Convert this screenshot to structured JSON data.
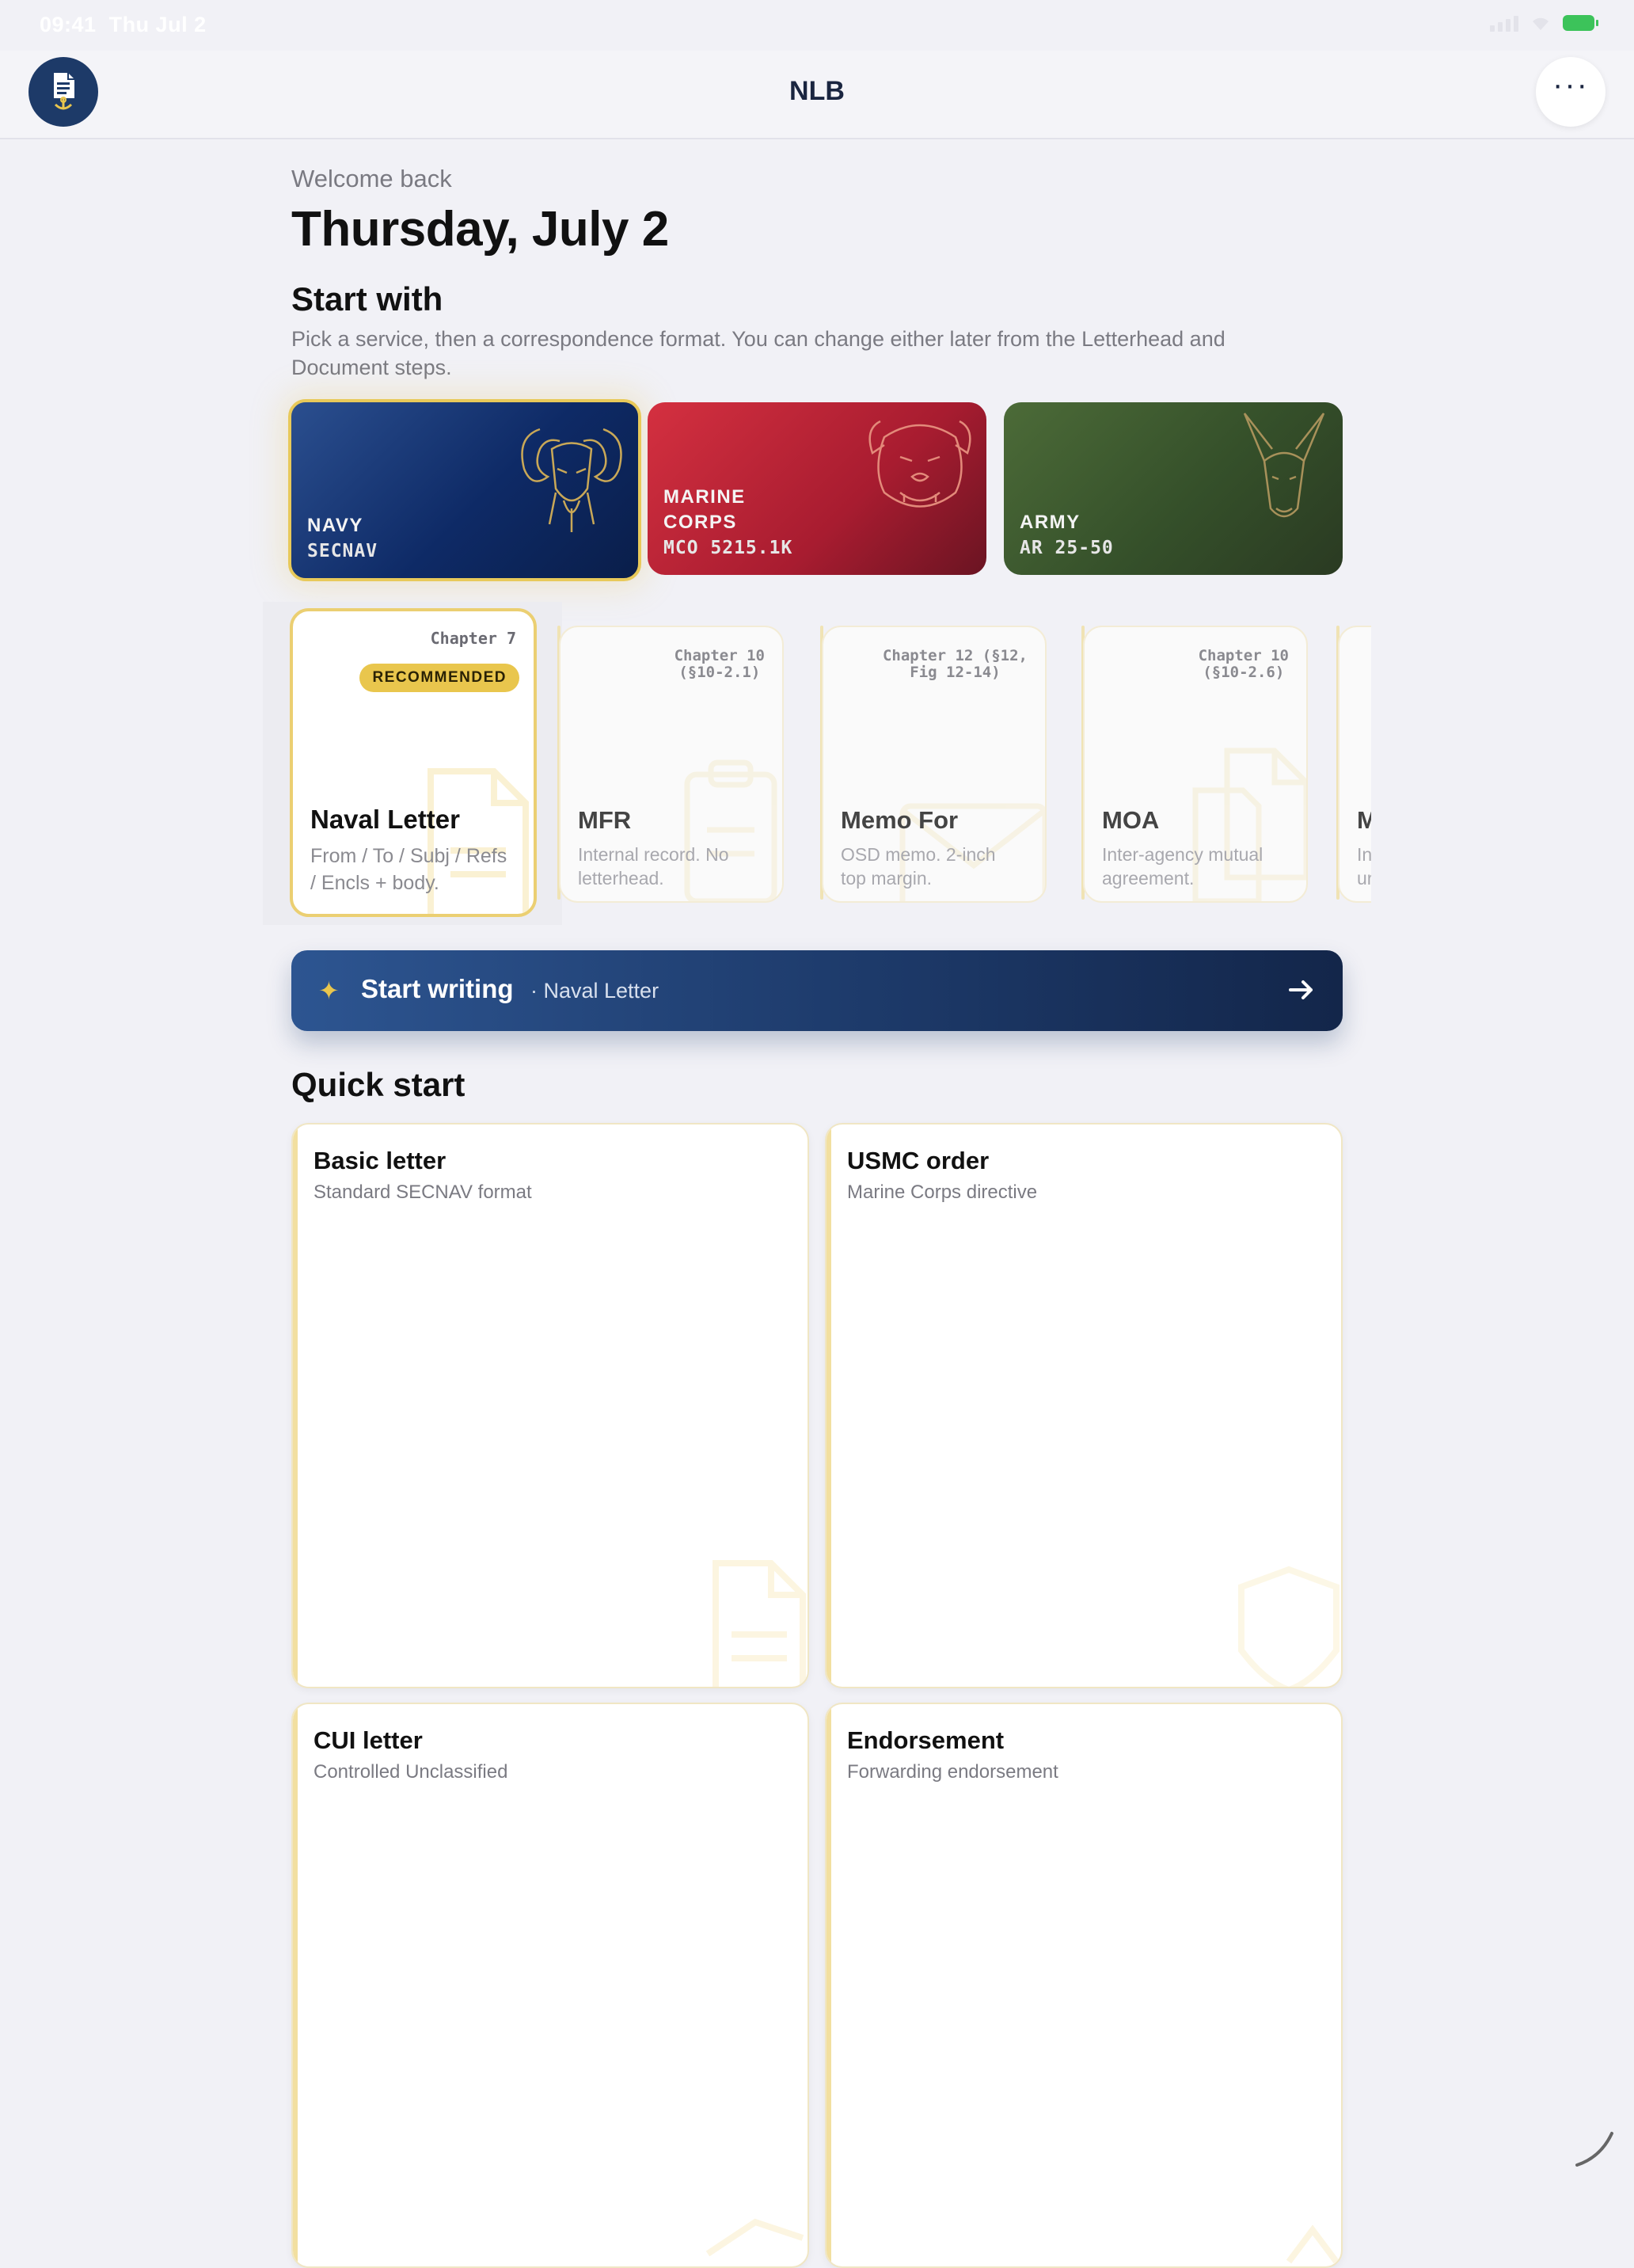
{
  "status_bar": {
    "time": "09:41",
    "date": "Thu Jul 2"
  },
  "nav": {
    "title": "NLB",
    "logo_icon": "anchor-document-icon",
    "menu_icon": "more-icon"
  },
  "header": {
    "welcome": "Welcome back",
    "date": "Thursday, July 2"
  },
  "start_with": {
    "title": "Start with",
    "subtitle": "Pick a service, then a correspondence format. You can change either later from the Letterhead and Document steps."
  },
  "services": [
    {
      "name": "NAVY",
      "code": "SECNAV",
      "selected": true,
      "mascot": "ram-icon"
    },
    {
      "name": "MARINE\nCORPS",
      "code": "MCO 5215.1K",
      "selected": false,
      "mascot": "bulldog-icon"
    },
    {
      "name": "ARMY",
      "code": "AR 25-50",
      "selected": false,
      "mascot": "mule-icon"
    }
  ],
  "formats": [
    {
      "chapter": "Chapter 7",
      "badge": "RECOMMENDED",
      "name": "Naval Letter",
      "desc": "From / To / Subj / Refs / Encls + body.",
      "selected": true
    },
    {
      "chapter": "Chapter 10\n(§10-2.1)",
      "name": "MFR",
      "desc": "Internal record. No letterhead."
    },
    {
      "chapter": "Chapter 12 (§12,\nFig 12-14)",
      "name": "Memo For",
      "desc": "OSD memo. 2-inch top margin."
    },
    {
      "chapter": "Chapter 10\n(§10-2.6)",
      "name": "MOA",
      "desc": "Inter-agency mutual agreement."
    },
    {
      "chapter": "",
      "name": "M",
      "desc": "In\nur"
    }
  ],
  "cta": {
    "label": "Start writing",
    "context": "· Naval Letter",
    "icon": "sparkle-icon",
    "arrow_icon": "arrow-right-icon"
  },
  "quick_start": {
    "title": "Quick start",
    "items": [
      {
        "title": "Basic letter",
        "subtitle": "Standard SECNAV format"
      },
      {
        "title": "USMC order",
        "subtitle": "Marine Corps directive"
      },
      {
        "title": "CUI letter",
        "subtitle": "Controlled Unclassified"
      },
      {
        "title": "Endorsement",
        "subtitle": "Forwarding endorsement"
      }
    ]
  },
  "colors": {
    "accent_gold": "#e9c64d",
    "navy": "#0e2a66",
    "marine": "#a81c30",
    "army": "#35502a"
  }
}
